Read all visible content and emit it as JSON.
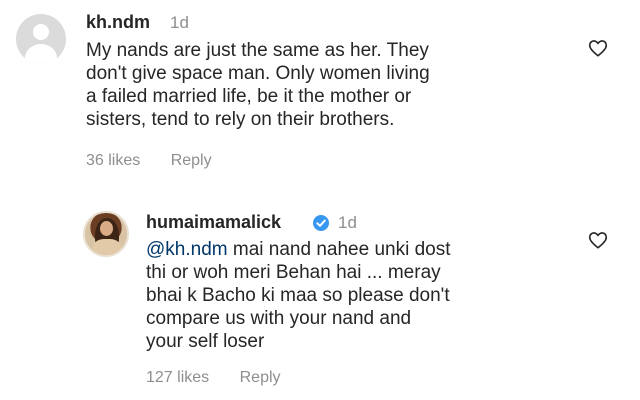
{
  "comments": [
    {
      "username": "kh.ndm",
      "time": "1d",
      "text_lines": [
        "My nands are just the same as her. They",
        "don't give space man. Only women living",
        "a failed married life, be it the mother or",
        "sisters, tend to rely on their brothers."
      ],
      "likes": "36 likes",
      "reply": "Reply",
      "avatar_icon": "default-avatar-icon",
      "like_icon": "heart-outline-icon"
    },
    {
      "username": "humaimamalick",
      "verified_icon": "verified-badge-icon",
      "time": "1d",
      "mention": "@kh.ndm",
      "text_first_rest": " mai nand nahee unki dost",
      "text_lines": [
        "thi or woh meri Behan hai ... meray",
        "bhai k Bacho ki maa so please don't",
        "compare us with your nand and",
        "your self loser"
      ],
      "likes": "127 likes",
      "reply": "Reply",
      "avatar_icon": "profile-photo",
      "like_icon": "heart-outline-icon"
    }
  ],
  "colors": {
    "text": "#262626",
    "secondary": "#8e8e8e",
    "mention": "#00376b",
    "verified": "#3897f0"
  }
}
